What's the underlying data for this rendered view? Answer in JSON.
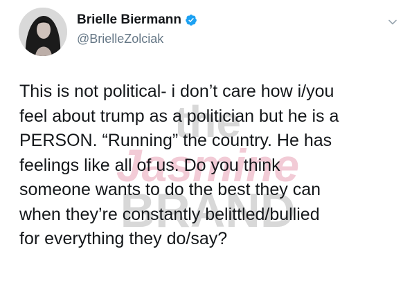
{
  "author": {
    "display_name": "Brielle Biermann",
    "handle": "@BrielleZolciak",
    "verified": true
  },
  "tweet": {
    "text": "This is not political- i don’t care how i/you\nfeel about trump as a politician but he is a\nPERSON. “Running” the country. He has\nfeelings like all of us. Do you think\nsomeone wants to do the best they can\nwhen they’re constantly belittled/bullied\nfor everything they do/say?"
  },
  "watermark": {
    "line1": "the",
    "line2": "Jasmine",
    "line3": "BRAND"
  },
  "colors": {
    "name": "#14171a",
    "handle": "#657786",
    "verified": "#1da1f2",
    "watermark_pink": "#e8a0b4",
    "watermark_gray": "#b8b8b8"
  },
  "icons": {
    "verified": "verified-badge-icon",
    "menu": "chevron-down-icon"
  }
}
